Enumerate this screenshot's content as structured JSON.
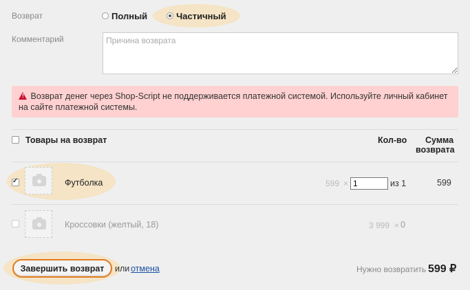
{
  "refund": {
    "label": "Возврат",
    "options": [
      {
        "label": "Полный",
        "checked": false
      },
      {
        "label": "Частичный",
        "checked": true
      }
    ]
  },
  "comment": {
    "label": "Комментарий",
    "placeholder": "Причина возврата",
    "value": ""
  },
  "alert": {
    "icon": "warning-icon",
    "text": "Возврат денег через Shop-Script не поддерживается платежной системой. Используйте личный кабинет на сайте платежной системы."
  },
  "table": {
    "header_product": "Товары на возврат",
    "header_qty": "Кол-во",
    "header_sum_line1": "Сумма",
    "header_sum_line2": "возврата",
    "rows": [
      {
        "name": "Футболка",
        "price": "599",
        "times": "×",
        "qty_value": "1",
        "of_text": "из 1",
        "sum": "599",
        "checked": true
      },
      {
        "name": "Кроссовки (желтый, 18)",
        "price": "3 999",
        "times": "×",
        "qty_text": "0",
        "sum": "",
        "checked": false
      }
    ]
  },
  "footer": {
    "submit_label": "Завершить возврат",
    "or_text": "или",
    "cancel_label": "отмена",
    "total_label": "Нужно возвратить",
    "total_value": "599 ₽"
  },
  "colors": {
    "accent": "#e07a1f",
    "highlight": "#f5e4c5",
    "alert_bg": "#ffd1d1",
    "link": "#1a4fa0"
  }
}
